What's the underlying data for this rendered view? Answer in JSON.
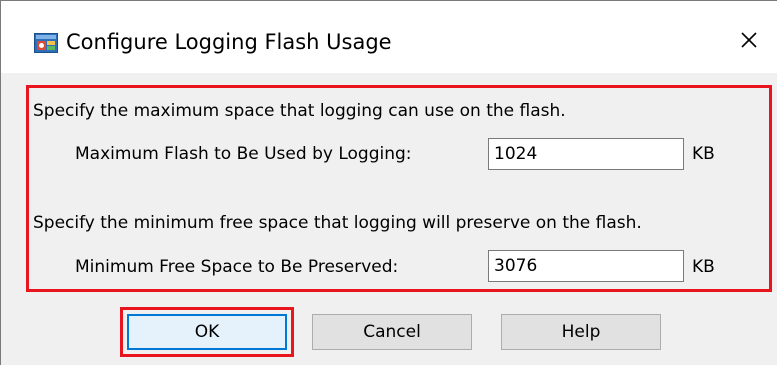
{
  "window": {
    "title": "Configure Logging Flash Usage",
    "close_symbol": "✕"
  },
  "icons": {
    "app": "app-config-icon",
    "close": "close-icon"
  },
  "settings": {
    "max_description": "Specify the maximum space that logging can use on the flash.",
    "max_label": "Maximum Flash to Be Used by Logging:",
    "max_value": "1024",
    "max_unit": "KB",
    "min_description": "Specify the minimum free space that logging will preserve on the flash.",
    "min_label": "Minimum Free Space to Be Preserved:",
    "min_value": "3076",
    "min_unit": "KB"
  },
  "buttons": {
    "ok": "OK",
    "cancel": "Cancel",
    "help": "Help"
  },
  "colors": {
    "highlight": "#e8141e",
    "default_button_border": "#0078d7"
  }
}
